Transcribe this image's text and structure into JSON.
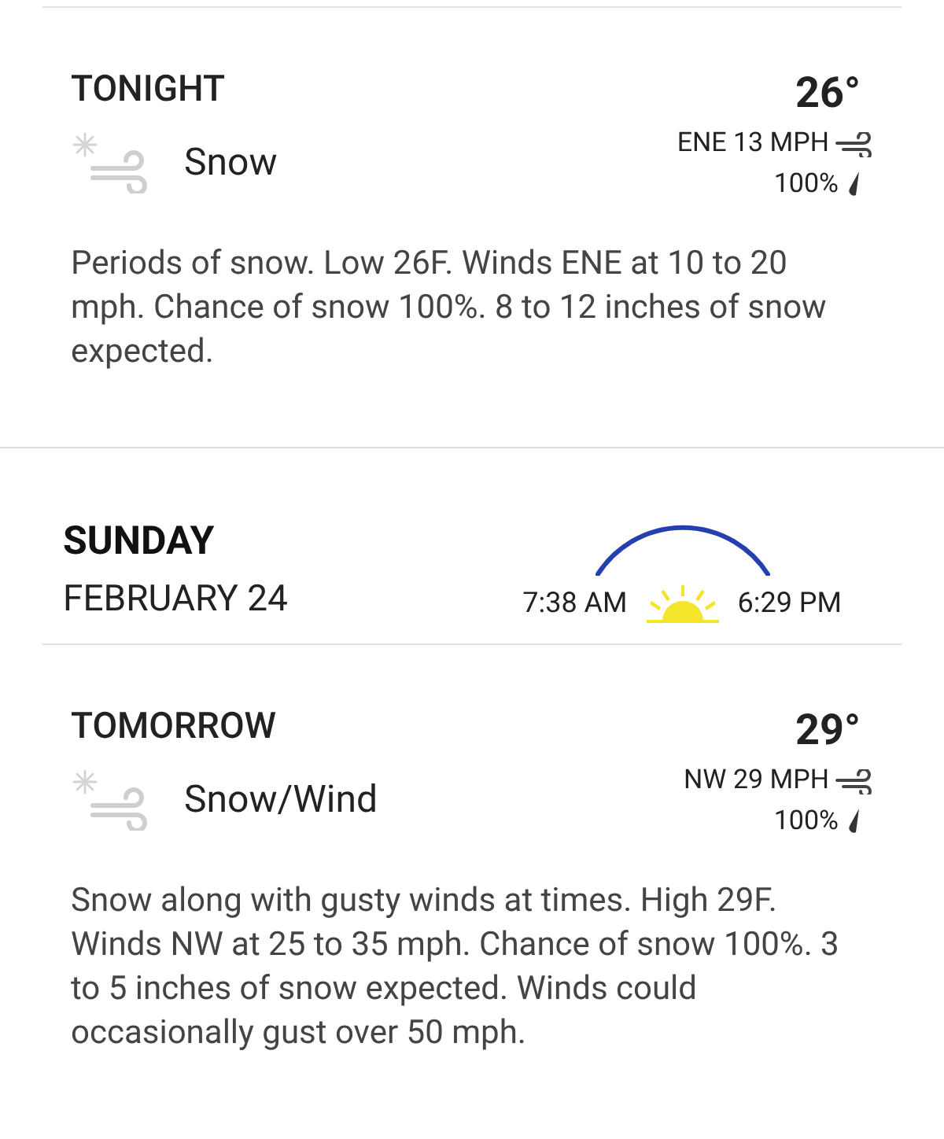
{
  "periods_top": [
    {
      "title": "TONIGHT",
      "temperature": "26°",
      "condition": "Snow",
      "wind": "ENE 13 MPH",
      "precipitation": "100%",
      "description": "Periods of snow. Low 26F. Winds ENE at 10 to 20 mph. Chance of snow 100%. 8 to 12 inches of snow expected."
    }
  ],
  "day": {
    "weekday": "SUNDAY",
    "date": "FEBRUARY 24",
    "sunrise": "7:38 AM",
    "sunset": "6:29 PM"
  },
  "periods_bottom": [
    {
      "title": "TOMORROW",
      "temperature": "29°",
      "condition": "Snow/Wind",
      "wind": "NW 29 MPH",
      "precipitation": "100%",
      "description": "Snow along with gusty winds at times. High 29F. Winds NW at 25 to 35 mph. Chance of snow 100%. 3 to 5 inches of snow expected. Winds could occasionally gust over 50 mph."
    }
  ]
}
